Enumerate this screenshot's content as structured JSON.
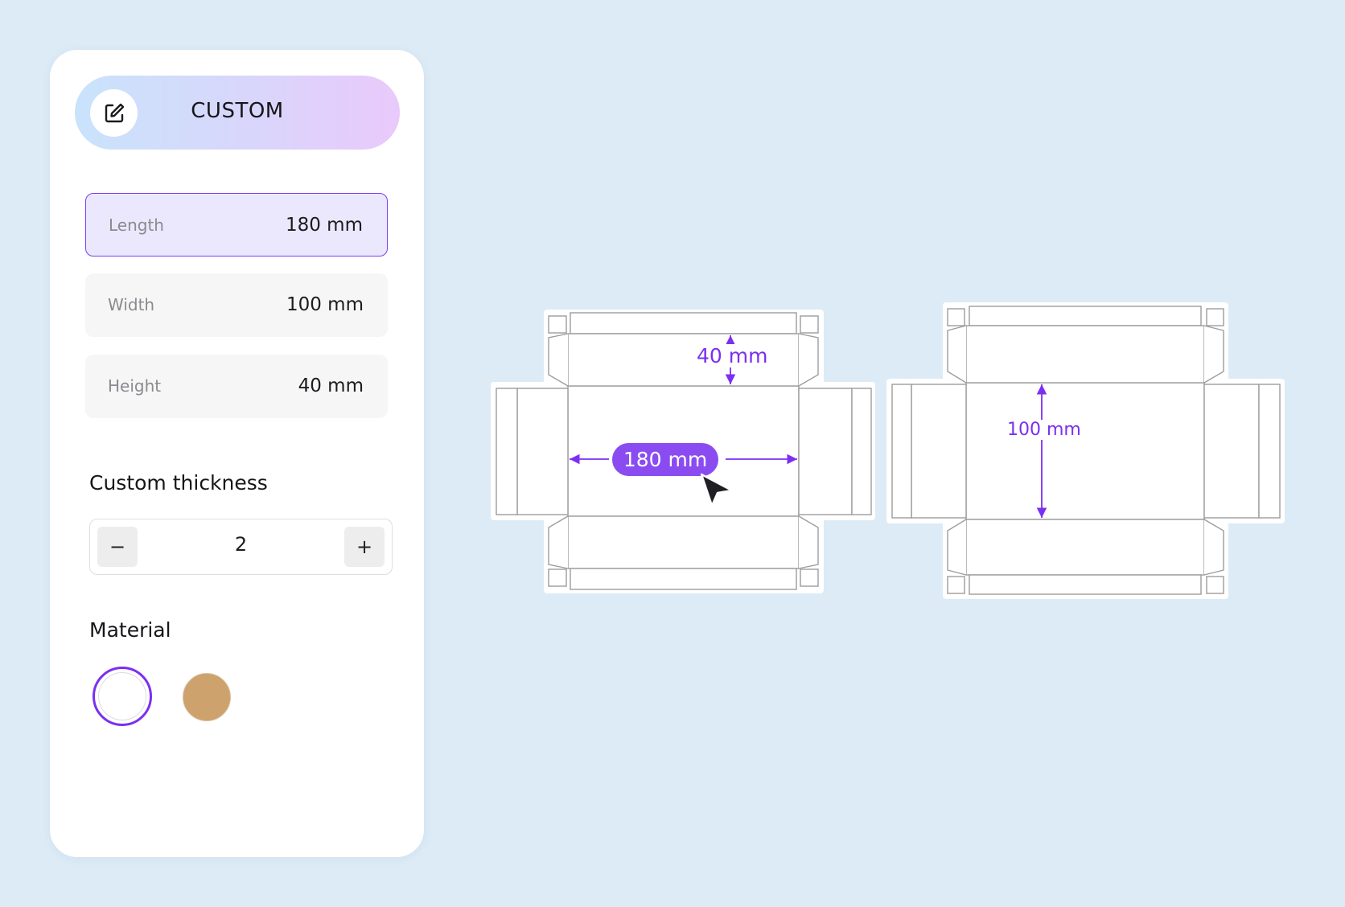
{
  "preset": {
    "label": "CUSTOM",
    "icon": "edit-icon"
  },
  "dimensions": {
    "length": {
      "label": "Length",
      "value": "180 mm"
    },
    "width": {
      "label": "Width",
      "value": "100 mm"
    },
    "height": {
      "label": "Height",
      "value": "40 mm"
    }
  },
  "thickness": {
    "title": "Custom thickness",
    "value": "2",
    "decrement_label": "−",
    "increment_label": "+"
  },
  "material": {
    "title": "Material",
    "options": [
      {
        "name": "white",
        "color": "#ffffff",
        "selected": true
      },
      {
        "name": "kraft",
        "color": "#cea26d",
        "selected": false
      }
    ]
  },
  "canvas": {
    "height_label": "40 mm",
    "length_label": "180 mm",
    "width_label": "100 mm"
  },
  "colors": {
    "accent": "#7b2ff2",
    "accent_pill": "#8a4cf1",
    "background": "#dcebf6"
  }
}
